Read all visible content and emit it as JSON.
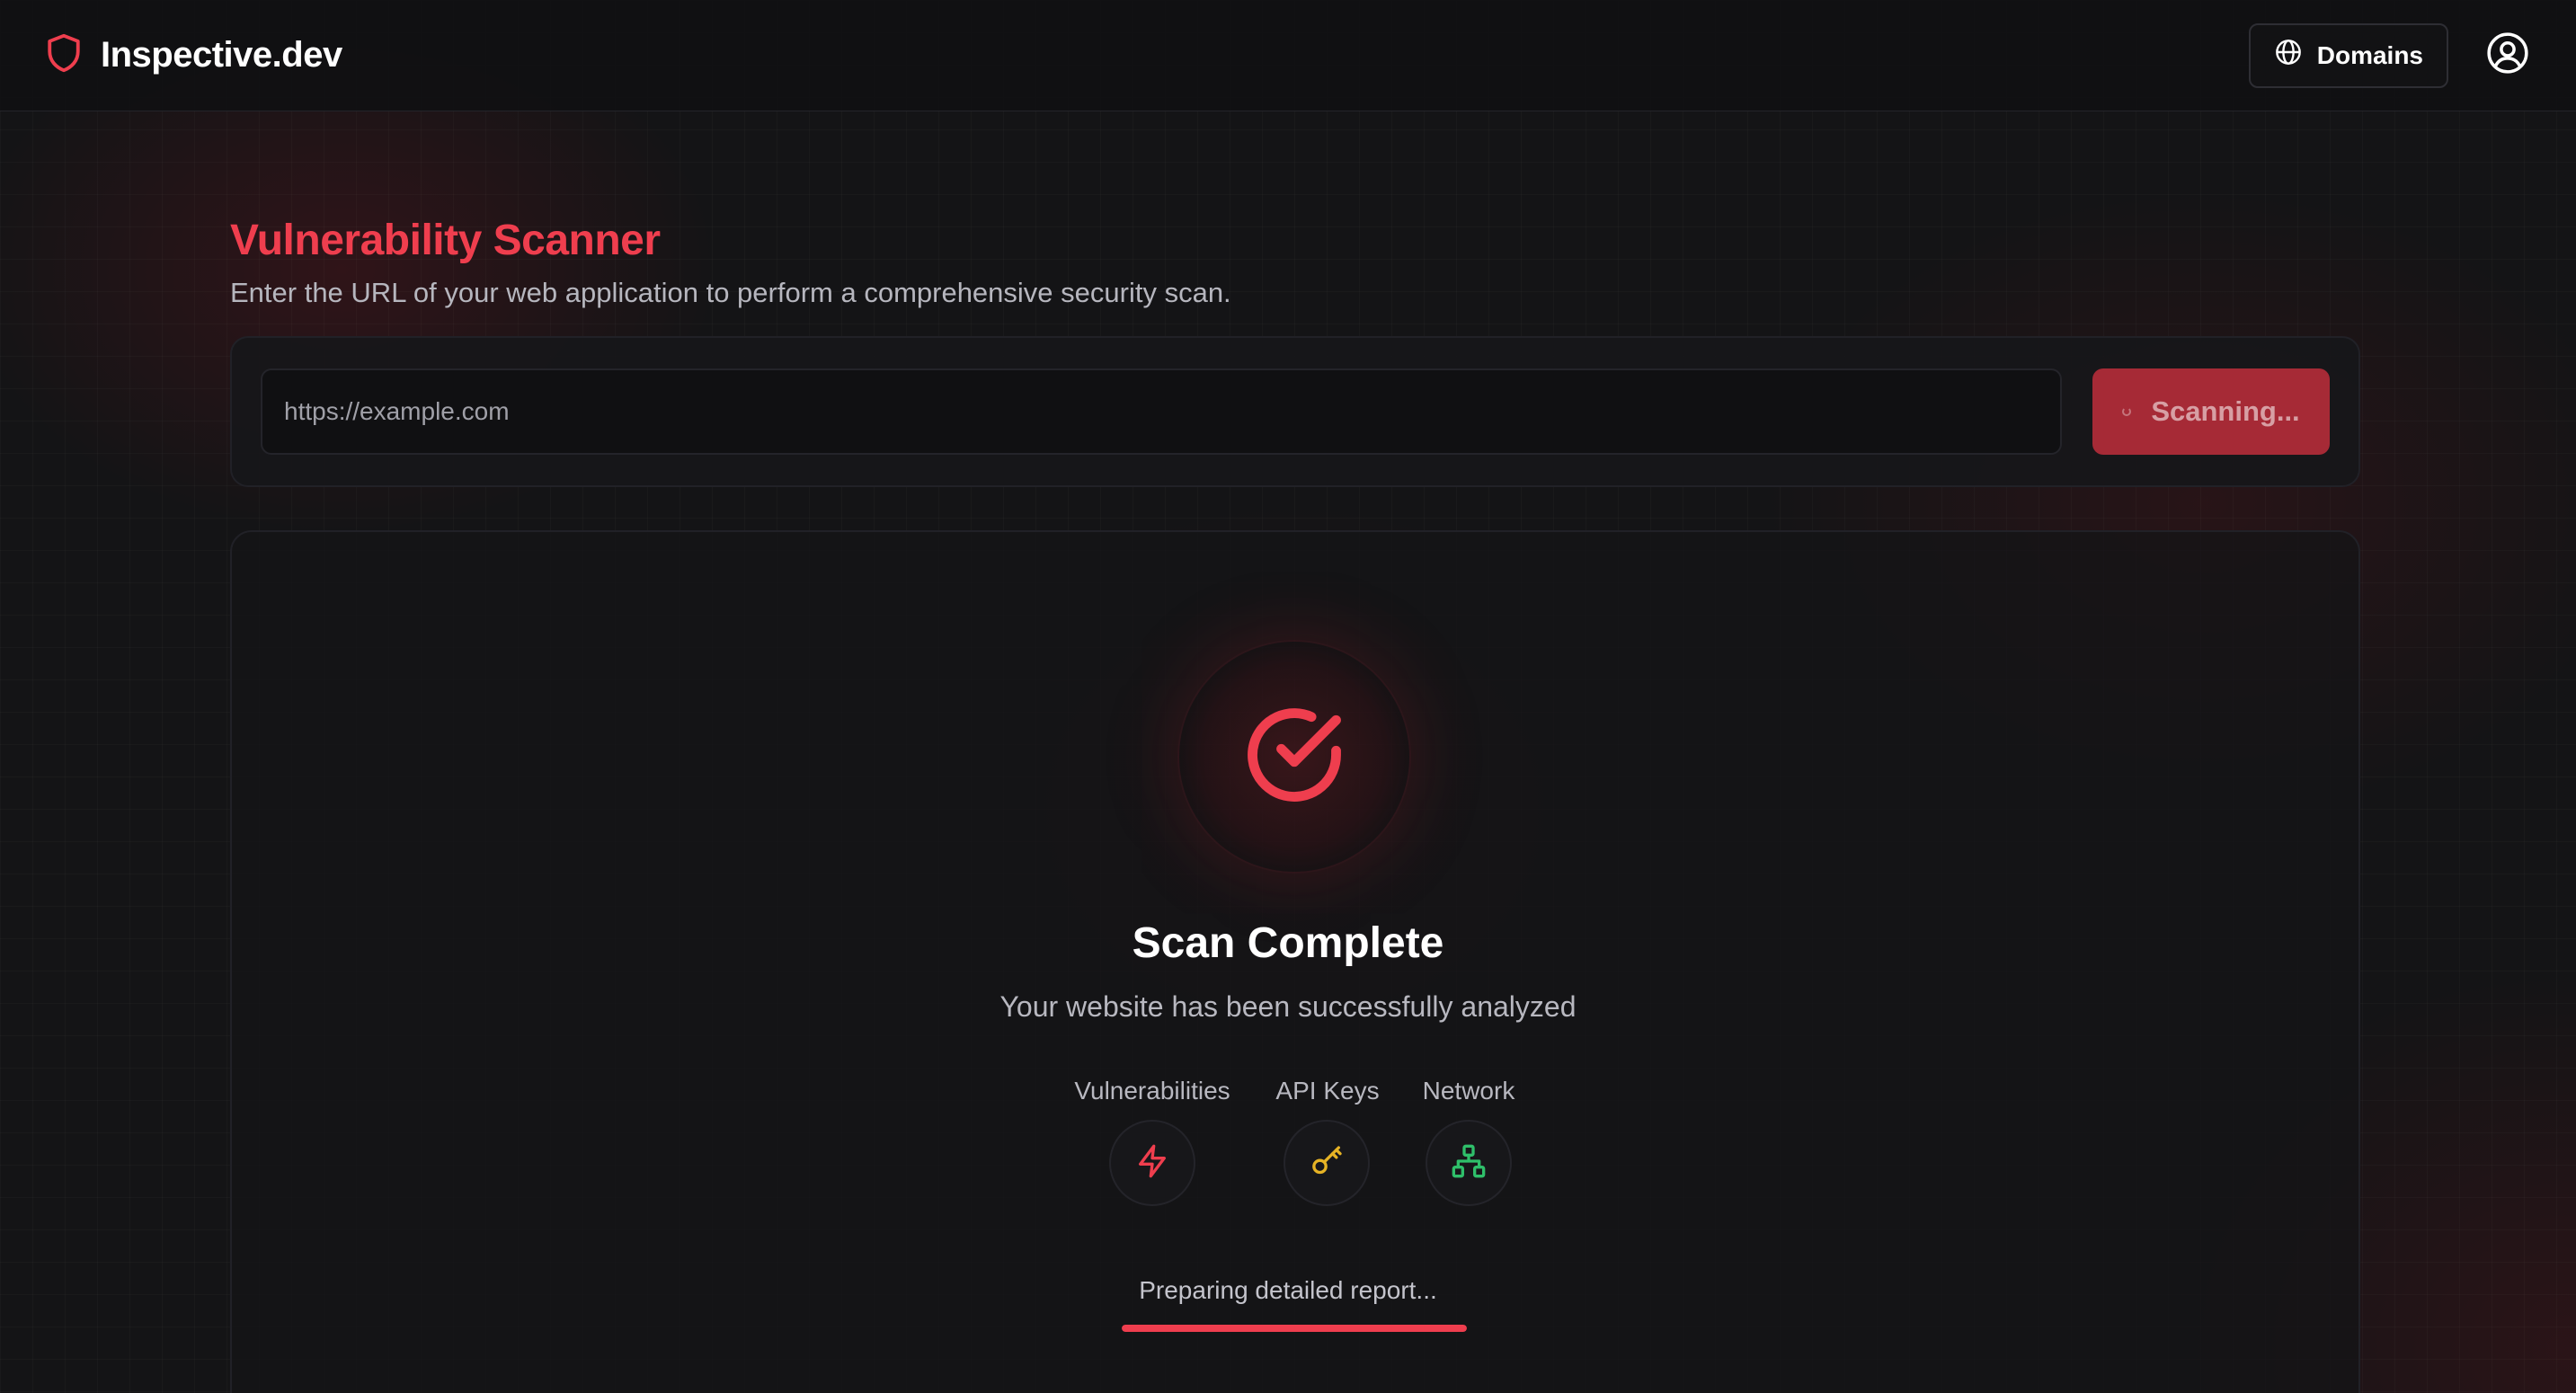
{
  "header": {
    "brand": "Inspective.dev",
    "domains_label": "Domains"
  },
  "scanner": {
    "title": "Vulnerability Scanner",
    "subtitle": "Enter the URL of your web application to perform a comprehensive security scan.",
    "url_value": "",
    "url_placeholder": "https://example.com",
    "scan_button_label": "Scanning..."
  },
  "result": {
    "title": "Scan Complete",
    "description": "Your website has been successfully analyzed",
    "categories": [
      {
        "label": "Vulnerabilities",
        "icon": "lightning-icon",
        "color": "#ef3e4e"
      },
      {
        "label": "API Keys",
        "icon": "key-icon",
        "color": "#e6b325"
      },
      {
        "label": "Network",
        "icon": "network-icon",
        "color": "#2fbf6a"
      }
    ],
    "report_status": "Preparing detailed report...",
    "report_progress": 1.0
  },
  "colors": {
    "accent": "#ef3e4e",
    "background": "#141416",
    "button": "#a62a36"
  }
}
